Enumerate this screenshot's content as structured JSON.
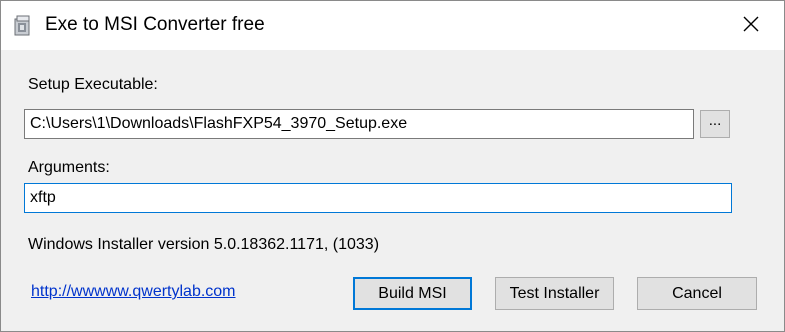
{
  "window": {
    "title": "Exe to MSI Converter free",
    "app_icon": "installer-package-icon",
    "close_icon": "close-icon"
  },
  "setup": {
    "label": "Setup Executable:",
    "value": "C:\\Users\\1\\Downloads\\FlashFXP54_3970_Setup.exe",
    "browse_label": "..."
  },
  "arguments": {
    "label": "Arguments:",
    "value": "xftp"
  },
  "installer_version": "Windows Installer version 5.0.18362.1171, (1033)",
  "link": "http://wwwww.qwertylab.com",
  "buttons": {
    "build": "Build MSI",
    "test": "Test Installer",
    "cancel": "Cancel"
  },
  "colors": {
    "accent": "#0078d7",
    "link": "#0033cc",
    "dialog_bg": "#f0f0f0"
  }
}
